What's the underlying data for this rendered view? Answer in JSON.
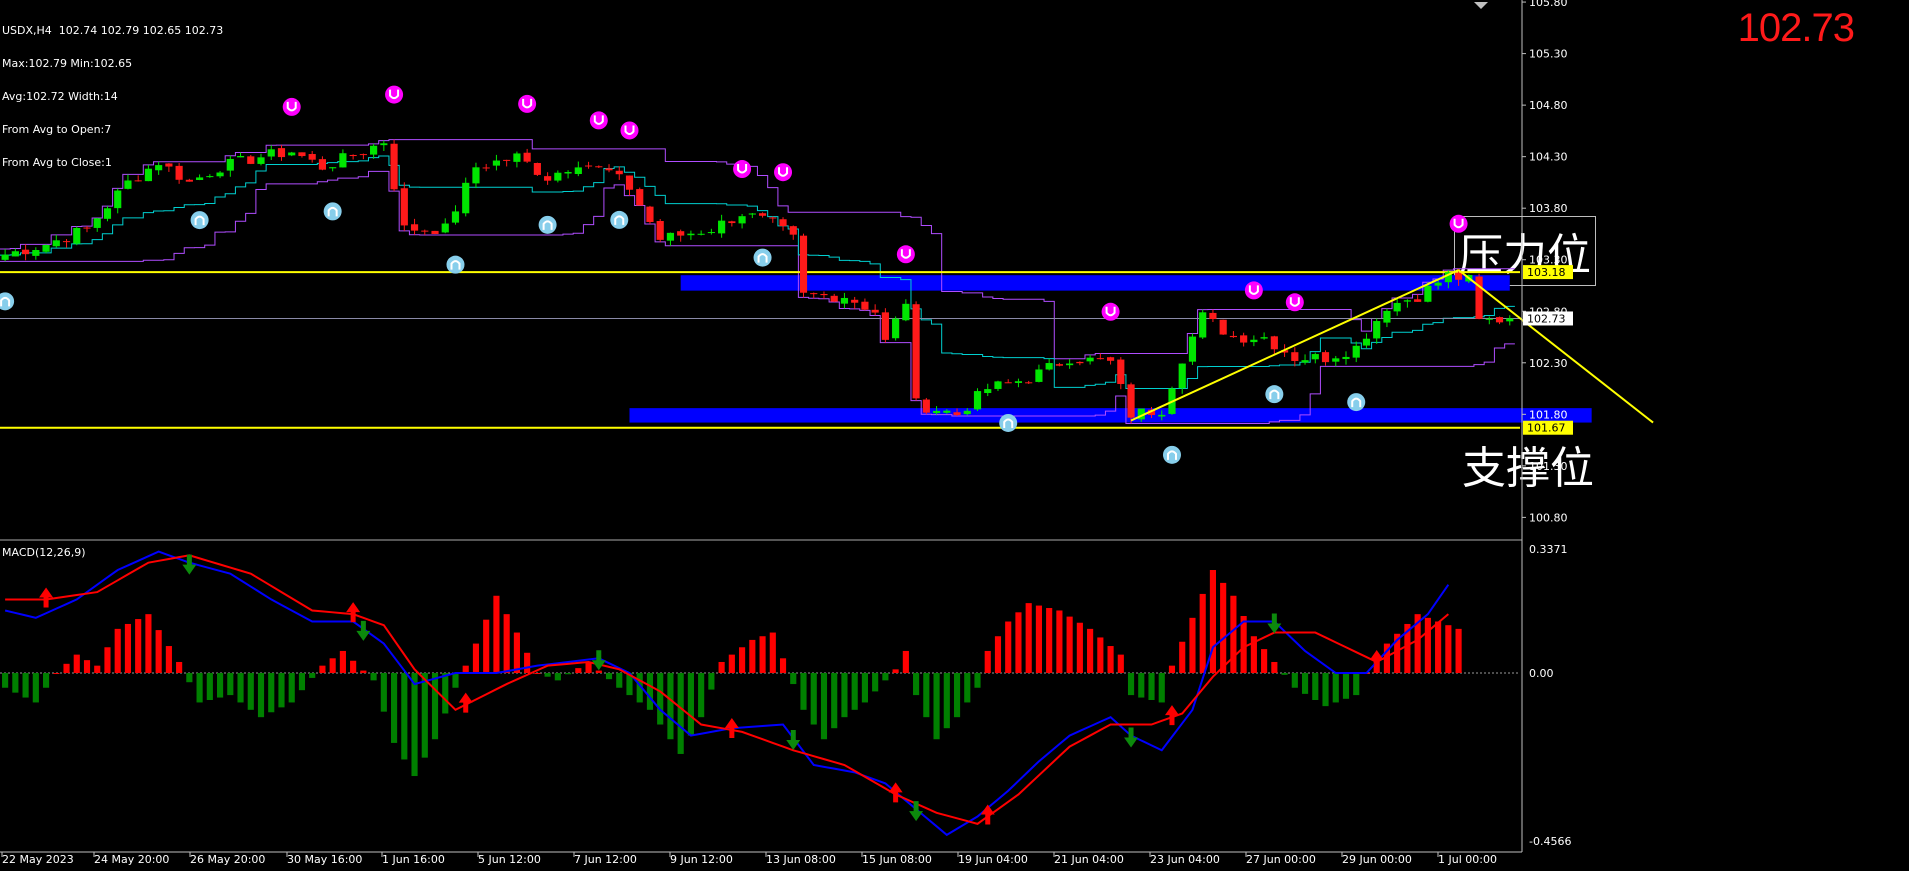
{
  "header": {
    "line1": "USDX,H4  102.74 102.79 102.65 102.73",
    "line2": "Max:102.79 Min:102.65",
    "line3": "Avg:102.72 Width:14",
    "line4": "From Avg to Open:7",
    "line5": "From Avg to Close:1"
  },
  "big_price": "102.73",
  "labels": {
    "resistance": "压力位",
    "support": "支撑位"
  },
  "macd_title": "MACD(12,26,9)",
  "colors": {
    "background": "#000000",
    "bull_candle": "#00e600",
    "bear_candle": "#ff1a1a",
    "channel": "#b04dff",
    "midline": "#00d0d0",
    "zone": "#0000ff",
    "level_line": "#ffff00",
    "macd_line": "#0000ff",
    "signal_line": "#ff0000",
    "hist_pos": "#ff0000",
    "hist_neg": "#008000",
    "fractal_up": "#ff00ff",
    "fractal_down": "#87ceeb"
  },
  "chart_data": [
    {
      "type": "candlestick",
      "symbol": "USDX",
      "timeframe": "H4",
      "last_price": 102.73,
      "ylim": [
        100.6,
        105.82
      ],
      "y_ticks": [
        "105.80",
        "105.30",
        "104.80",
        "104.30",
        "103.80",
        "103.30",
        "102.80",
        "102.30",
        "101.80",
        "101.30",
        "100.80"
      ],
      "x_ticks": [
        "22 May 2023",
        "24 May 20:00",
        "26 May 20:00",
        "30 May 16:00",
        "1 Jun 16:00",
        "5 Jun 12:00",
        "7 Jun 12:00",
        "9 Jun 12:00",
        "13 Jun 08:00",
        "15 Jun 08:00",
        "19 Jun 04:00",
        "21 Jun 04:00",
        "23 Jun 04:00",
        "27 Jun 00:00",
        "29 Jun 00:00",
        "1 Jul 00:00"
      ],
      "price_labels": [
        {
          "text": "103.18",
          "value": 103.18,
          "style": "yellow"
        },
        {
          "text": "102.73",
          "value": 102.73,
          "style": "white"
        },
        {
          "text": "101.67",
          "value": 101.67,
          "style": "yellow"
        }
      ],
      "horizontal_lines": [
        103.18,
        101.67
      ],
      "zones": [
        {
          "from_index": 66,
          "to_index": 147,
          "low": 103.0,
          "high": 103.15
        },
        {
          "from_index": 61,
          "to_index": 155,
          "low": 101.72,
          "high": 101.86
        }
      ],
      "trendlines": [
        {
          "from_index": 110,
          "from_price": 101.74,
          "to_index": 142,
          "to_price": 103.2
        },
        {
          "from_index": 142,
          "from_price": 103.2,
          "to_index": 161,
          "to_price": 101.72
        }
      ],
      "anchors": [
        {
          "index": 0,
          "price": 103.35
        },
        {
          "index": 4,
          "price": 103.45
        },
        {
          "index": 8,
          "price": 103.6
        },
        {
          "index": 12,
          "price": 104.05
        },
        {
          "index": 15,
          "price": 104.25
        },
        {
          "index": 18,
          "price": 104.05
        },
        {
          "index": 21,
          "price": 104.2
        },
        {
          "index": 25,
          "price": 104.3
        },
        {
          "index": 28,
          "price": 104.35
        },
        {
          "index": 31,
          "price": 104.2
        },
        {
          "index": 35,
          "price": 104.35
        },
        {
          "index": 37,
          "price": 104.45
        },
        {
          "index": 39,
          "price": 103.6
        },
        {
          "index": 43,
          "price": 103.6
        },
        {
          "index": 46,
          "price": 104.2
        },
        {
          "index": 50,
          "price": 104.3
        },
        {
          "index": 53,
          "price": 104.1
        },
        {
          "index": 56,
          "price": 104.25
        },
        {
          "index": 59,
          "price": 104.15
        },
        {
          "index": 61,
          "price": 104.0
        },
        {
          "index": 64,
          "price": 103.5
        },
        {
          "index": 69,
          "price": 103.6
        },
        {
          "index": 72,
          "price": 103.75
        },
        {
          "index": 75,
          "price": 103.65
        },
        {
          "index": 77,
          "price": 103.5
        },
        {
          "index": 78,
          "price": 102.95
        },
        {
          "index": 82,
          "price": 102.95
        },
        {
          "index": 85,
          "price": 102.8
        },
        {
          "index": 86,
          "price": 102.5
        },
        {
          "index": 88,
          "price": 102.9
        },
        {
          "index": 89,
          "price": 101.9
        },
        {
          "index": 93,
          "price": 101.8
        },
        {
          "index": 96,
          "price": 102.05
        },
        {
          "index": 100,
          "price": 102.15
        },
        {
          "index": 104,
          "price": 102.35
        },
        {
          "index": 108,
          "price": 102.3
        },
        {
          "index": 110,
          "price": 101.8
        },
        {
          "index": 113,
          "price": 101.85
        },
        {
          "index": 115,
          "price": 102.35
        },
        {
          "index": 117,
          "price": 102.75
        },
        {
          "index": 120,
          "price": 102.55
        },
        {
          "index": 123,
          "price": 102.55
        },
        {
          "index": 126,
          "price": 102.35
        },
        {
          "index": 129,
          "price": 102.35
        },
        {
          "index": 132,
          "price": 102.45
        },
        {
          "index": 135,
          "price": 102.85
        },
        {
          "index": 138,
          "price": 102.95
        },
        {
          "index": 141,
          "price": 103.15
        },
        {
          "index": 143,
          "price": 103.1
        },
        {
          "index": 144,
          "price": 102.7
        },
        {
          "index": 147,
          "price": 102.73
        }
      ],
      "fractals_up_index": [
        28,
        38,
        51,
        58,
        61,
        72,
        76,
        88,
        108,
        122,
        126,
        142
      ],
      "fractals_down_index": [
        0,
        19,
        32,
        44,
        53,
        60,
        74,
        98,
        114,
        124,
        132
      ]
    },
    {
      "type": "bar",
      "name": "MACD(12,26,9)",
      "ylim": [
        -0.4566,
        0.3371
      ],
      "y_ticks": [
        "0.3371",
        "0.00",
        "-0.4566"
      ],
      "zero_line": 0.0,
      "hist_anchors": [
        {
          "index": 0,
          "value": -0.04
        },
        {
          "index": 3,
          "value": -0.08
        },
        {
          "index": 5,
          "value": 0.0
        },
        {
          "index": 7,
          "value": 0.05
        },
        {
          "index": 9,
          "value": 0.02
        },
        {
          "index": 11,
          "value": 0.12
        },
        {
          "index": 14,
          "value": 0.16
        },
        {
          "index": 17,
          "value": 0.03
        },
        {
          "index": 19,
          "value": -0.08
        },
        {
          "index": 22,
          "value": -0.06
        },
        {
          "index": 25,
          "value": -0.12
        },
        {
          "index": 28,
          "value": -0.08
        },
        {
          "index": 31,
          "value": 0.02
        },
        {
          "index": 33,
          "value": 0.06
        },
        {
          "index": 36,
          "value": -0.02
        },
        {
          "index": 38,
          "value": -0.19
        },
        {
          "index": 40,
          "value": -0.28
        },
        {
          "index": 42,
          "value": -0.18
        },
        {
          "index": 44,
          "value": -0.04
        },
        {
          "index": 46,
          "value": 0.08
        },
        {
          "index": 48,
          "value": 0.21
        },
        {
          "index": 50,
          "value": 0.11
        },
        {
          "index": 52,
          "value": 0.0
        },
        {
          "index": 54,
          "value": -0.02
        },
        {
          "index": 57,
          "value": 0.03
        },
        {
          "index": 60,
          "value": -0.04
        },
        {
          "index": 63,
          "value": -0.1
        },
        {
          "index": 66,
          "value": -0.22
        },
        {
          "index": 68,
          "value": -0.12
        },
        {
          "index": 70,
          "value": 0.03
        },
        {
          "index": 73,
          "value": 0.09
        },
        {
          "index": 75,
          "value": 0.11
        },
        {
          "index": 78,
          "value": -0.1
        },
        {
          "index": 80,
          "value": -0.18
        },
        {
          "index": 82,
          "value": -0.12
        },
        {
          "index": 84,
          "value": -0.08
        },
        {
          "index": 87,
          "value": 0.01
        },
        {
          "index": 88,
          "value": 0.06
        },
        {
          "index": 89,
          "value": -0.06
        },
        {
          "index": 91,
          "value": -0.18
        },
        {
          "index": 93,
          "value": -0.12
        },
        {
          "index": 95,
          "value": -0.04
        },
        {
          "index": 96,
          "value": 0.06
        },
        {
          "index": 98,
          "value": 0.14
        },
        {
          "index": 100,
          "value": 0.19
        },
        {
          "index": 103,
          "value": 0.17
        },
        {
          "index": 106,
          "value": 0.12
        },
        {
          "index": 109,
          "value": 0.05
        },
        {
          "index": 110,
          "value": -0.06
        },
        {
          "index": 113,
          "value": -0.08
        },
        {
          "index": 114,
          "value": 0.02
        },
        {
          "index": 116,
          "value": 0.15
        },
        {
          "index": 118,
          "value": 0.28
        },
        {
          "index": 120,
          "value": 0.21
        },
        {
          "index": 122,
          "value": 0.1
        },
        {
          "index": 124,
          "value": 0.03
        },
        {
          "index": 126,
          "value": -0.04
        },
        {
          "index": 129,
          "value": -0.09
        },
        {
          "index": 132,
          "value": -0.06
        },
        {
          "index": 133,
          "value": 0.0
        },
        {
          "index": 135,
          "value": 0.08
        },
        {
          "index": 138,
          "value": 0.16
        },
        {
          "index": 140,
          "value": 0.14
        },
        {
          "index": 142,
          "value": 0.12
        }
      ],
      "macd_anchors": [
        {
          "index": 0,
          "value": 0.17
        },
        {
          "index": 3,
          "value": 0.15
        },
        {
          "index": 7,
          "value": 0.2
        },
        {
          "index": 11,
          "value": 0.28
        },
        {
          "index": 15,
          "value": 0.33
        },
        {
          "index": 18,
          "value": 0.3
        },
        {
          "index": 22,
          "value": 0.27
        },
        {
          "index": 26,
          "value": 0.2
        },
        {
          "index": 30,
          "value": 0.14
        },
        {
          "index": 34,
          "value": 0.14
        },
        {
          "index": 37,
          "value": 0.08
        },
        {
          "index": 40,
          "value": -0.03
        },
        {
          "index": 44,
          "value": 0.0
        },
        {
          "index": 48,
          "value": 0.0
        },
        {
          "index": 52,
          "value": 0.02
        },
        {
          "index": 55,
          "value": 0.03
        },
        {
          "index": 58,
          "value": 0.04
        },
        {
          "index": 61,
          "value": 0.0
        },
        {
          "index": 64,
          "value": -0.1
        },
        {
          "index": 67,
          "value": -0.17
        },
        {
          "index": 71,
          "value": -0.15
        },
        {
          "index": 76,
          "value": -0.14
        },
        {
          "index": 79,
          "value": -0.25
        },
        {
          "index": 83,
          "value": -0.27
        },
        {
          "index": 86,
          "value": -0.3
        },
        {
          "index": 89,
          "value": -0.37
        },
        {
          "index": 92,
          "value": -0.44
        },
        {
          "index": 95,
          "value": -0.39
        },
        {
          "index": 98,
          "value": -0.32
        },
        {
          "index": 101,
          "value": -0.24
        },
        {
          "index": 104,
          "value": -0.17
        },
        {
          "index": 108,
          "value": -0.12
        },
        {
          "index": 110,
          "value": -0.17
        },
        {
          "index": 113,
          "value": -0.21
        },
        {
          "index": 116,
          "value": -0.1
        },
        {
          "index": 118,
          "value": 0.07
        },
        {
          "index": 121,
          "value": 0.14
        },
        {
          "index": 124,
          "value": 0.14
        },
        {
          "index": 127,
          "value": 0.06
        },
        {
          "index": 130,
          "value": 0.0
        },
        {
          "index": 133,
          "value": 0.0
        },
        {
          "index": 136,
          "value": 0.09
        },
        {
          "index": 139,
          "value": 0.16
        },
        {
          "index": 141,
          "value": 0.24
        }
      ],
      "signal_anchors": [
        {
          "index": 0,
          "value": 0.2
        },
        {
          "index": 4,
          "value": 0.2
        },
        {
          "index": 9,
          "value": 0.22
        },
        {
          "index": 14,
          "value": 0.3
        },
        {
          "index": 18,
          "value": 0.32
        },
        {
          "index": 24,
          "value": 0.27
        },
        {
          "index": 30,
          "value": 0.17
        },
        {
          "index": 34,
          "value": 0.16
        },
        {
          "index": 37,
          "value": 0.13
        },
        {
          "index": 40,
          "value": 0.01
        },
        {
          "index": 44,
          "value": -0.1
        },
        {
          "index": 49,
          "value": -0.03
        },
        {
          "index": 53,
          "value": 0.02
        },
        {
          "index": 57,
          "value": 0.03
        },
        {
          "index": 60,
          "value": 0.01
        },
        {
          "index": 64,
          "value": -0.05
        },
        {
          "index": 68,
          "value": -0.14
        },
        {
          "index": 72,
          "value": -0.16
        },
        {
          "index": 77,
          "value": -0.21
        },
        {
          "index": 82,
          "value": -0.25
        },
        {
          "index": 87,
          "value": -0.33
        },
        {
          "index": 91,
          "value": -0.38
        },
        {
          "index": 95,
          "value": -0.41
        },
        {
          "index": 99,
          "value": -0.33
        },
        {
          "index": 104,
          "value": -0.2
        },
        {
          "index": 108,
          "value": -0.14
        },
        {
          "index": 112,
          "value": -0.14
        },
        {
          "index": 115,
          "value": -0.11
        },
        {
          "index": 118,
          "value": -0.01
        },
        {
          "index": 121,
          "value": 0.07
        },
        {
          "index": 124,
          "value": 0.11
        },
        {
          "index": 128,
          "value": 0.11
        },
        {
          "index": 131,
          "value": 0.07
        },
        {
          "index": 134,
          "value": 0.03
        },
        {
          "index": 138,
          "value": 0.09
        },
        {
          "index": 141,
          "value": 0.16
        }
      ],
      "buy_arrows_index": [
        4,
        34,
        45,
        71,
        87,
        96,
        114,
        134
      ],
      "sell_arrows_index": [
        18,
        35,
        58,
        77,
        89,
        110,
        124
      ]
    }
  ]
}
